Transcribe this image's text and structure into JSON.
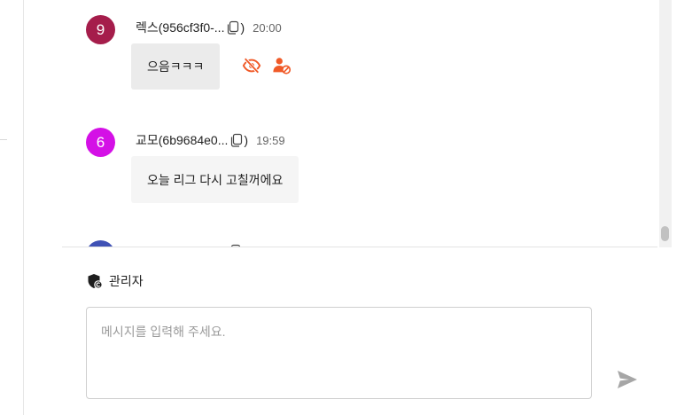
{
  "messages": [
    {
      "avatar_text": "9",
      "avatar_color": "#a51d4b",
      "name": "렉스(956cf3f0-...",
      "paren": ")",
      "time": "20:00",
      "text": "으음ㅋㅋㅋ",
      "bubble_color": "#ebebeb",
      "icons": [
        "eye-slash-icon",
        "user-block-icon"
      ],
      "icon_color": "#f05a28"
    },
    {
      "avatar_text": "6",
      "avatar_color": "#d410e6",
      "name": "교모(6b9684e0...",
      "paren": ")",
      "time": "19:59",
      "text": "오늘 리그 다시 고칠꺼에요",
      "bubble_color": "#f5f5f5"
    },
    {
      "avatar_color": "#3f51b5"
    }
  ],
  "composer": {
    "role_icon": "admin-shield-icon",
    "role_label": "관리자",
    "placeholder": "메시지를 입력해 주세요.",
    "send_icon": "send-icon"
  }
}
